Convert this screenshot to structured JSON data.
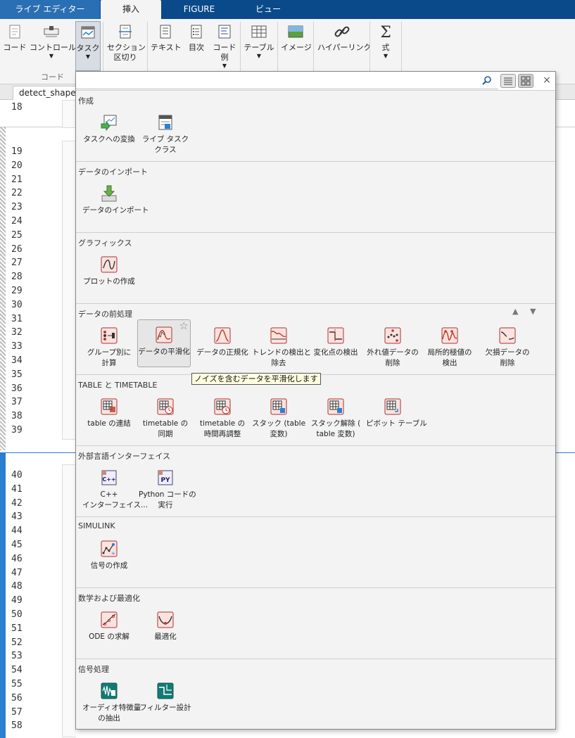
{
  "tabs": [
    "ライブ エディター",
    "挿入",
    "FIGURE",
    "ビュー"
  ],
  "ribbon": {
    "buttons": [
      {
        "label": "コード",
        "arrow": false
      },
      {
        "label": "コントロール",
        "arrow": true
      },
      {
        "label": "タスク",
        "arrow": true
      },
      {
        "label": "セクション",
        "label2": "区切り",
        "arrow": false
      },
      {
        "label": "テキスト",
        "arrow": false
      },
      {
        "label": "目次",
        "arrow": false
      },
      {
        "label": "コード",
        "label2": "例",
        "arrow": true
      },
      {
        "label": "テーブル",
        "arrow": true
      },
      {
        "label": "イメージ",
        "arrow": false
      },
      {
        "label": "ハイパーリンク",
        "arrow": false
      },
      {
        "label": "式",
        "arrow": true
      }
    ],
    "group_label": "コード",
    "arrow_glyph": "▼"
  },
  "document": {
    "tab_label": "detect_shape_",
    "line_numbers": [
      "18",
      "19",
      "20",
      "21",
      "22",
      "23",
      "24",
      "25",
      "26",
      "27",
      "28",
      "29",
      "30",
      "31",
      "32",
      "33",
      "34",
      "35",
      "36",
      "37",
      "38",
      "39",
      "40",
      "41",
      "42",
      "43",
      "44",
      "45",
      "46",
      "47",
      "48",
      "49",
      "50",
      "51",
      "52",
      "53",
      "54",
      "55",
      "56",
      "57",
      "58"
    ]
  },
  "gallery": {
    "search": {
      "value": "",
      "placeholder": ""
    },
    "close_glyph": "×",
    "sort_up": "▲",
    "sort_down": "▼",
    "star": "☆",
    "tooltip": "ノイズを含むデータを平滑化します",
    "sections": [
      {
        "title": "作成",
        "items": [
          {
            "l1": "タスクへの変換",
            "l2": "",
            "icon": "convert-to-task-icon"
          },
          {
            "l1": "ライブ タスク",
            "l2": "クラス",
            "icon": "live-task-class-icon"
          }
        ]
      },
      {
        "title": "データのインポート",
        "items": [
          {
            "l1": "データのインポート",
            "l2": "",
            "icon": "import-data-icon"
          }
        ]
      },
      {
        "title": "グラフィックス",
        "items": [
          {
            "l1": "プロットの作成",
            "l2": "",
            "icon": "create-plot-icon"
          }
        ]
      },
      {
        "title": "データの前処理",
        "items": [
          {
            "l1": "グループ別に",
            "l2": "計算",
            "icon": "group-compute-icon"
          },
          {
            "l1": "データの平滑化",
            "l2": "",
            "icon": "smooth-data-icon"
          },
          {
            "l1": "データの正規化",
            "l2": "",
            "icon": "normalize-data-icon"
          },
          {
            "l1": "トレンドの検出と",
            "l2": "除去",
            "icon": "detrend-icon"
          },
          {
            "l1": "変化点の検出",
            "l2": "",
            "icon": "change-point-icon"
          },
          {
            "l1": "外れ値データの",
            "l2": "削除",
            "icon": "outlier-icon"
          },
          {
            "l1": "局所的極値の",
            "l2": "検出",
            "icon": "local-extrema-icon"
          },
          {
            "l1": "欠損データの",
            "l2": "削除",
            "icon": "missing-data-icon"
          }
        ]
      },
      {
        "title": "TABLE と TIMETABLE",
        "items": [
          {
            "l1": "table の連結",
            "l2": "",
            "icon": "join-tables-icon"
          },
          {
            "l1": "timetable の",
            "l2": "同期",
            "icon": "sync-timetable-icon"
          },
          {
            "l1": "timetable の",
            "l2": "時間再調整",
            "icon": "retime-timetable-icon"
          },
          {
            "l1": "スタック (table",
            "l2": "変数)",
            "icon": "stack-table-icon"
          },
          {
            "l1": "スタック解除 (",
            "l2": "table 変数)",
            "icon": "unstack-table-icon"
          },
          {
            "l1": "ピボット テーブル",
            "l2": "",
            "icon": "pivot-table-icon"
          }
        ]
      },
      {
        "title": "外部言語インターフェイス",
        "items": [
          {
            "l1": "C++",
            "l2": "インターフェイス...",
            "icon": "cpp-interface-icon",
            "badge": "C++"
          },
          {
            "l1": "Python コードの",
            "l2": "実行",
            "icon": "python-icon",
            "badge": "PY"
          }
        ]
      },
      {
        "title": "SIMULINK",
        "items": [
          {
            "l1": "信号の作成",
            "l2": "",
            "icon": "create-signal-icon"
          }
        ]
      },
      {
        "title": "数学および最適化",
        "items": [
          {
            "l1": "ODE の求解",
            "l2": "",
            "icon": "solve-ode-icon"
          },
          {
            "l1": "最適化",
            "l2": "",
            "icon": "optimize-icon"
          }
        ]
      },
      {
        "title": "信号処理",
        "items": [
          {
            "l1": "オーディオ特徴量",
            "l2": "の抽出",
            "icon": "audio-features-icon"
          },
          {
            "l1": "フィルター設計",
            "l2": "",
            "icon": "filter-design-icon"
          }
        ]
      }
    ]
  },
  "colors": {
    "tabbar": "#0b4a8a",
    "accent": "#2a7fd1",
    "icon_red": "#c0392b",
    "icon_teal": "#127a73"
  }
}
